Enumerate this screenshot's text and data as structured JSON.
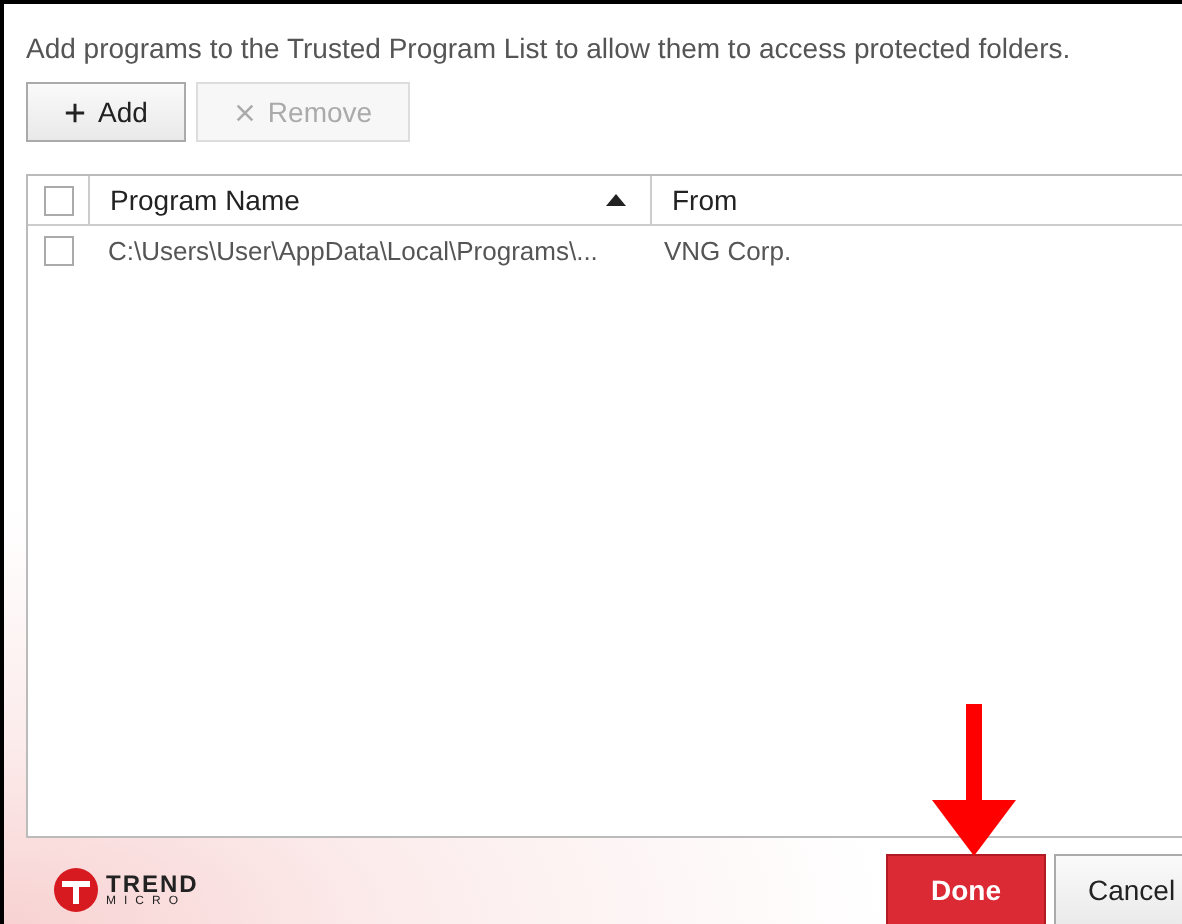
{
  "description": "Add programs to the Trusted Program List to allow them to access protected folders.",
  "toolbar": [
    {
      "kind": "add",
      "label": "Add",
      "disabled": false
    },
    {
      "kind": "remove",
      "label": "Remove",
      "disabled": true
    }
  ],
  "table": {
    "header_checked": false,
    "columns": [
      {
        "label": "Program Name",
        "sorted": true
      },
      {
        "label": "From",
        "sorted": false
      }
    ],
    "rows": [
      {
        "checked": false,
        "cells": [
          "C:\\Users\\User\\AppData\\Local\\Programs\\...",
          "VNG Corp."
        ]
      }
    ]
  },
  "logo": {
    "line_1": "TREND",
    "line_2": "MICRO"
  },
  "buttons": [
    {
      "label": "Done",
      "kind": "primary"
    },
    {
      "label": "Cancel",
      "kind": "secondary"
    }
  ],
  "annotation": {
    "kind": "arrow"
  }
}
